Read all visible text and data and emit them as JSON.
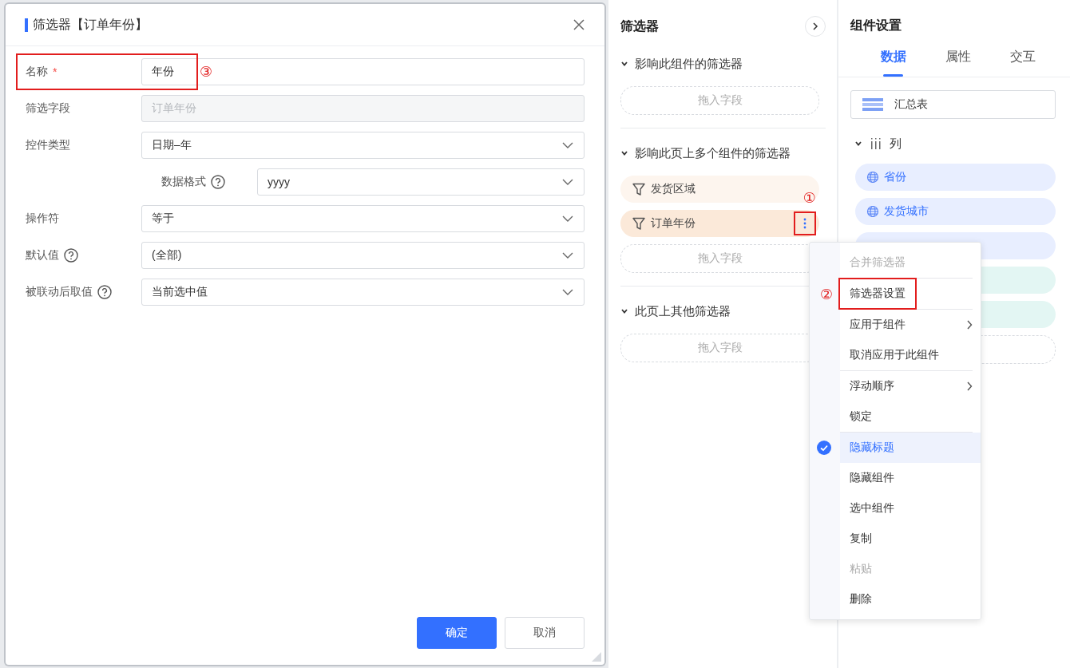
{
  "dialog": {
    "title": "筛选器【订单年份】",
    "fields": [
      {
        "label": "名称",
        "required_mark": "*",
        "help": false,
        "kind": "input",
        "value": "年份",
        "disabled": false,
        "annotation": "③"
      },
      {
        "label": "筛选字段",
        "help": false,
        "kind": "input",
        "value": "订单年份",
        "disabled": true
      },
      {
        "label": "控件类型",
        "help": false,
        "kind": "select",
        "value": "日期–年",
        "disabled": false,
        "children": [
          {
            "label": "数据格式",
            "help": true,
            "kind": "select",
            "value": "yyyy",
            "disabled": false
          }
        ]
      },
      {
        "label": "操作符",
        "help": false,
        "kind": "select",
        "value": "等于",
        "disabled": false
      },
      {
        "label": "默认值",
        "help": true,
        "kind": "select",
        "value": "(全部)",
        "disabled": false
      },
      {
        "label": "被联动后取值",
        "help": true,
        "kind": "select",
        "value": "当前选中值",
        "disabled": false
      }
    ],
    "buttons": [
      {
        "label": "确定",
        "primary": true
      },
      {
        "label": "取消",
        "primary": false
      }
    ]
  },
  "filter_panel": {
    "title": "筛选器",
    "sections": [
      {
        "title": "影响此组件的筛选器",
        "expanded": true,
        "drop_zone": "拖入字段"
      },
      {
        "title": "影响此页上多个组件的筛选器",
        "expanded": true,
        "filters": [
          {
            "label": "发货区域",
            "selected": false
          },
          {
            "label": "订单年份",
            "selected": true,
            "annotation": "①"
          }
        ],
        "drop_zone": "拖入字段"
      },
      {
        "title": "此页上其他筛选器",
        "expanded": true,
        "drop_zone": "拖入字段"
      }
    ]
  },
  "settings_panel": {
    "title": "组件设置",
    "tabs": [
      {
        "label": "数据",
        "selected": true
      },
      {
        "label": "属性",
        "selected": false
      },
      {
        "label": "交互",
        "selected": false
      }
    ],
    "component": "汇总表",
    "group": {
      "label": "列",
      "expanded": true,
      "fields": [
        {
          "label": "省份",
          "kind": "dimension"
        },
        {
          "label": "发货城市",
          "kind": "dimension"
        },
        {
          "kind": "dimension"
        },
        {
          "kind": "measure"
        },
        {
          "kind": "measure"
        }
      ]
    }
  },
  "context_menu": {
    "groups": [
      [
        {
          "label": "合并筛选器",
          "disabled": true,
          "checked": false,
          "submenu": false,
          "highlighted": false
        }
      ],
      [
        {
          "label": "筛选器设置",
          "disabled": false,
          "checked": false,
          "submenu": false,
          "highlighted": true,
          "annotation": "②"
        }
      ],
      [
        {
          "label": "应用于组件",
          "disabled": false,
          "checked": false,
          "submenu": true,
          "highlighted": false
        },
        {
          "label": "取消应用于此组件",
          "disabled": false,
          "checked": false,
          "submenu": false,
          "highlighted": false
        }
      ],
      [
        {
          "label": "浮动顺序",
          "disabled": false,
          "checked": false,
          "submenu": true,
          "highlighted": false
        },
        {
          "label": "锁定",
          "disabled": false,
          "checked": false,
          "submenu": false,
          "highlighted": false
        }
      ],
      [
        {
          "label": "隐藏标题",
          "disabled": false,
          "checked": true,
          "submenu": false,
          "highlighted": false
        },
        {
          "label": "隐藏组件",
          "disabled": false,
          "checked": false,
          "submenu": false,
          "highlighted": false
        },
        {
          "label": "选中组件",
          "disabled": false,
          "checked": false,
          "submenu": false,
          "highlighted": false
        },
        {
          "label": "复制",
          "disabled": false,
          "checked": false,
          "submenu": false,
          "highlighted": false
        },
        {
          "label": "粘贴",
          "disabled": true,
          "checked": false,
          "submenu": false,
          "highlighted": false
        },
        {
          "label": "删除",
          "disabled": false,
          "checked": false,
          "submenu": false,
          "highlighted": false
        }
      ]
    ]
  }
}
